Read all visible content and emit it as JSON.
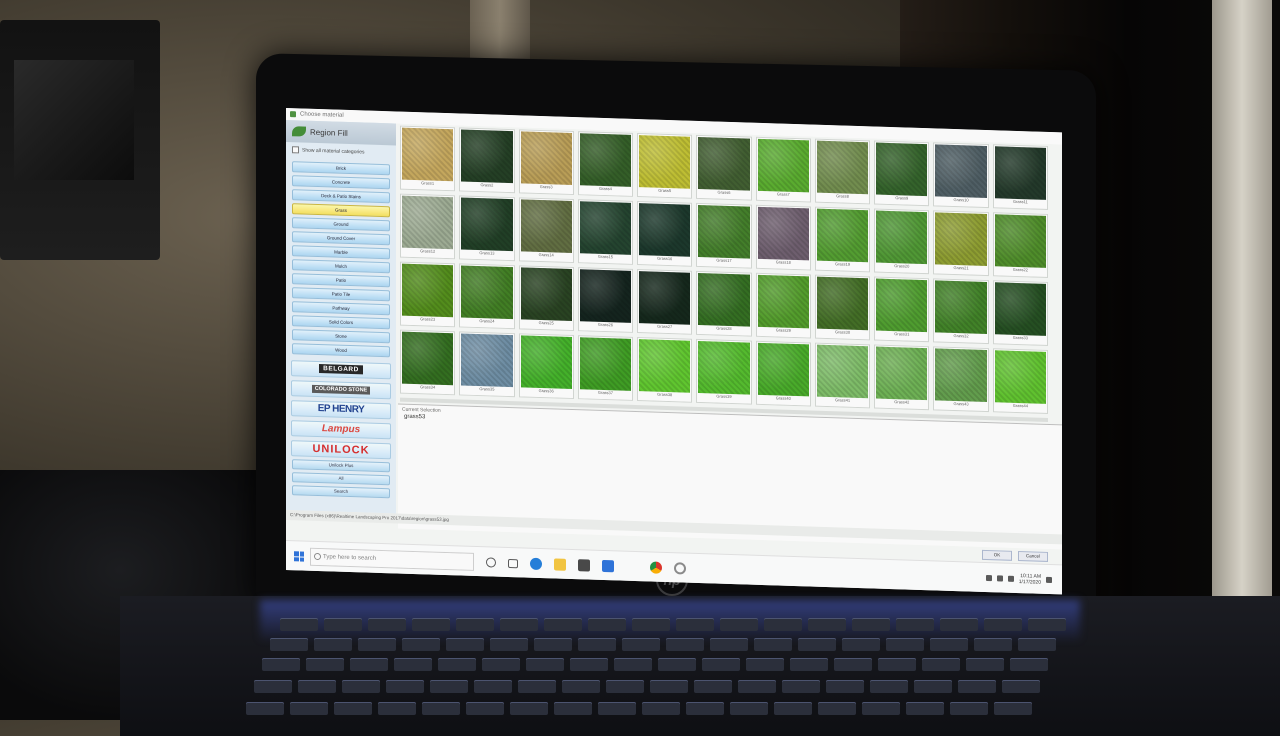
{
  "window": {
    "title": "Choose material"
  },
  "sidebar": {
    "title": "Region Fill",
    "show_all_label": "Show all material categories",
    "categories": [
      "Brick",
      "Concrete",
      "Deck & Patio Stains",
      "Grass",
      "Ground",
      "Ground Cover",
      "Marble",
      "Mulch",
      "Patio",
      "Patio Tile",
      "Pathway",
      "Solid Colors",
      "Stone",
      "Wood"
    ],
    "selected_category": "Grass",
    "brands": [
      "BELGARD",
      "COLORADO STONE",
      "EP HENRY",
      "Lampus",
      "UNILOCK"
    ],
    "bottom_items": [
      "Unilock Plus",
      "All",
      "Search"
    ]
  },
  "grid": {
    "tiles": [
      {
        "label": "Grass1",
        "color": "#c2a459"
      },
      {
        "label": "Grass2",
        "color": "#1e3a1f"
      },
      {
        "label": "Grass3",
        "color": "#b79b52"
      },
      {
        "label": "Grass4",
        "color": "#2f5a22"
      },
      {
        "label": "Grass5",
        "color": "#bcbc2e"
      },
      {
        "label": "Grass6",
        "color": "#3c5a2c"
      },
      {
        "label": "Grass7",
        "color": "#55a92a"
      },
      {
        "label": "Grass8",
        "color": "#6e8a4a"
      },
      {
        "label": "Grass9",
        "color": "#2f5f25"
      },
      {
        "label": "Grass10",
        "color": "#4a5a60"
      },
      {
        "label": "Grass11",
        "color": "#1d3424"
      },
      {
        "label": "Grass12",
        "color": "#9aa890"
      },
      {
        "label": "Grass13",
        "color": "#1b3a20"
      },
      {
        "label": "Grass14",
        "color": "#5d6a3d"
      },
      {
        "label": "Grass15",
        "color": "#1e3f2a"
      },
      {
        "label": "Grass16",
        "color": "#163326"
      },
      {
        "label": "Grass17",
        "color": "#3e7a24"
      },
      {
        "label": "Grass18",
        "color": "#6a5a6a"
      },
      {
        "label": "Grass19",
        "color": "#4e9a2c"
      },
      {
        "label": "Grass20",
        "color": "#4b9530"
      },
      {
        "label": "Grass21",
        "color": "#8a9a2c"
      },
      {
        "label": "Grass22",
        "color": "#4a8a24"
      },
      {
        "label": "Grass23",
        "color": "#4e8a16"
      },
      {
        "label": "Grass24",
        "color": "#3c7a1e"
      },
      {
        "label": "Grass25",
        "color": "#233e1c"
      },
      {
        "label": "Grass26",
        "color": "#0e1e18"
      },
      {
        "label": "Grass27",
        "color": "#0f2216"
      },
      {
        "label": "Grass28",
        "color": "#2f6a1c"
      },
      {
        "label": "Grass29",
        "color": "#4e9a26"
      },
      {
        "label": "Grass30",
        "color": "#3e6a20"
      },
      {
        "label": "Grass31",
        "color": "#4a9a2a"
      },
      {
        "label": "Grass32",
        "color": "#3c7e22"
      },
      {
        "label": "Grass33",
        "color": "#1f4a1c"
      },
      {
        "label": "Grass34",
        "color": "#2e6a1a"
      },
      {
        "label": "Grass35",
        "color": "#6a8aa0"
      },
      {
        "label": "Grass36",
        "color": "#3fae24"
      },
      {
        "label": "Grass37",
        "color": "#3a9a1e"
      },
      {
        "label": "Grass38",
        "color": "#5cc42a"
      },
      {
        "label": "Grass39",
        "color": "#4fb828"
      },
      {
        "label": "Grass40",
        "color": "#44a824"
      },
      {
        "label": "Grass41",
        "color": "#7aba64"
      },
      {
        "label": "Grass42",
        "color": "#6aae50"
      },
      {
        "label": "Grass43",
        "color": "#5e9a48"
      },
      {
        "label": "Grass44",
        "color": "#5cc02a"
      }
    ]
  },
  "selection": {
    "caption": "Current Selection",
    "name": "grass53"
  },
  "status_bar": {
    "path": "C:\\Program Files (x86)\\Realtime Landscaping Pro 2017\\data\\region\\grass53.jpg"
  },
  "buttons": {
    "ok": "OK",
    "cancel": "Cancel"
  },
  "taskbar": {
    "search_placeholder": "Type here to search",
    "time": "10:11 AM",
    "date": "1/17/2020"
  }
}
